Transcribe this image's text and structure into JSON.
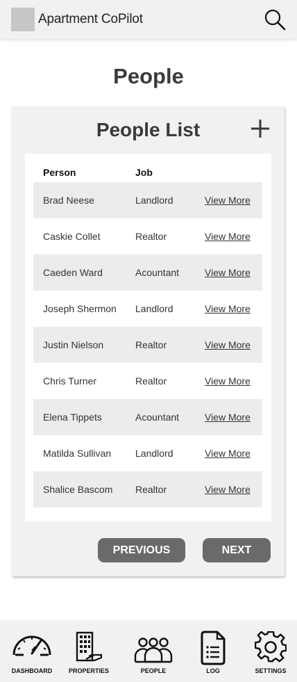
{
  "header": {
    "app_title": "Apartment CoPilot",
    "logo_icon": "app-logo-placeholder",
    "search_icon": "search-icon"
  },
  "page": {
    "title": "People"
  },
  "people_list": {
    "title": "People List",
    "add_icon": "plus-icon",
    "columns": [
      "Person",
      "Job",
      ""
    ],
    "rows": [
      {
        "name": "Brad Neese",
        "job": "Landlord",
        "action": "View More"
      },
      {
        "name": "Caskie Collet",
        "job": "Realtor",
        "action": "View More"
      },
      {
        "name": "Caeden Ward",
        "job": "Acountant",
        "action": "View More"
      },
      {
        "name": "Joseph Shermon",
        "job": "Landlord",
        "action": "View More"
      },
      {
        "name": "Justin Nielson",
        "job": "Realtor",
        "action": "View More"
      },
      {
        "name": "Chris Turner",
        "job": "Realtor",
        "action": "View More"
      },
      {
        "name": "Elena Tippets",
        "job": "Acountant",
        "action": "View More"
      },
      {
        "name": "Matilda Sullivan",
        "job": "Landlord",
        "action": "View More"
      },
      {
        "name": "Shalice Bascom",
        "job": "Realtor",
        "action": "View More"
      }
    ],
    "previous_label": "PREVIOUS",
    "next_label": "NEXT"
  },
  "nav": {
    "items": [
      {
        "label": "DASHBOARD",
        "icon": "dashboard-gauge-icon"
      },
      {
        "label": "PROPERTIES",
        "icon": "building-icon"
      },
      {
        "label": "PEOPLE",
        "icon": "people-icon"
      },
      {
        "label": "LOG",
        "icon": "document-icon"
      },
      {
        "label": "SETTINGS",
        "icon": "gear-icon"
      }
    ]
  },
  "colors": {
    "header_bg": "#f1f1f1",
    "card_bg": "#f1f1f1",
    "shaded_row": "#ececec",
    "button_bg": "#6a6a6a",
    "title_text": "#3a3a3a"
  }
}
